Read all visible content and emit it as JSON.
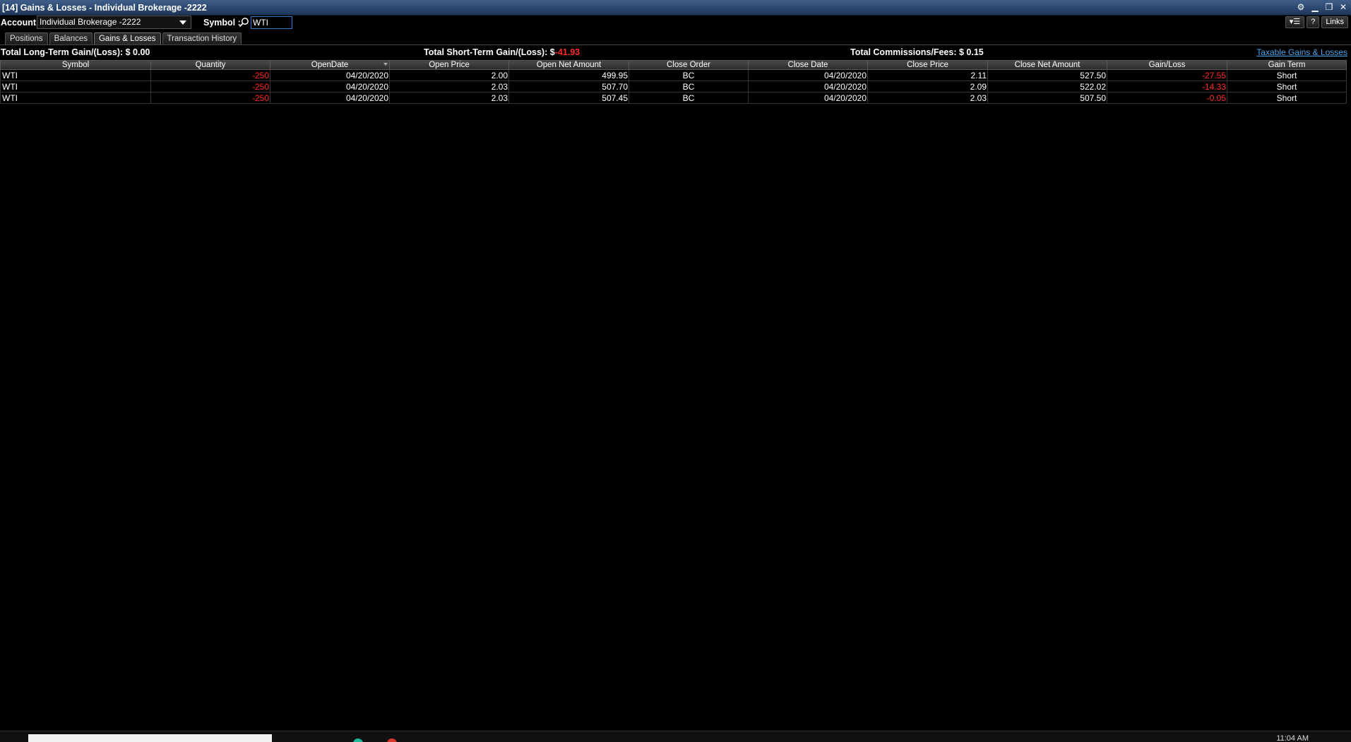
{
  "window": {
    "title": "[14] Gains & Losses - Individual Brokerage -2222"
  },
  "toolbar": {
    "account_label": "Account :",
    "account_value": "Individual Brokerage -2222",
    "symbol_label": "Symbol :",
    "symbol_value": "WTI",
    "help_label": "?",
    "links_label": "Links"
  },
  "tabs": [
    {
      "label": "Positions"
    },
    {
      "label": "Balances"
    },
    {
      "label": "Gains & Losses",
      "active": true
    },
    {
      "label": "Transaction History"
    }
  ],
  "summary": {
    "long_term_label": "Total Long-Term Gain/(Loss):",
    "long_term_value": "$ 0.00",
    "short_term_label": "Total Short-Term Gain/(Loss):",
    "short_term_currency": "$",
    "short_term_value": "-41.93",
    "fees_label": "Total Commissions/Fees:",
    "fees_value": "$ 0.15",
    "taxable_link": "Taxable Gains & Losses"
  },
  "table": {
    "columns": [
      "Symbol",
      "Quantity",
      "OpenDate",
      "Open Price",
      "Open Net Amount",
      "Close Order",
      "Close Date",
      "Close Price",
      "Close Net Amount",
      "Gain/Loss",
      "Gain Term"
    ],
    "rows": [
      [
        "WTI",
        "-250",
        "04/20/2020",
        "2.00",
        "499.95",
        "BC",
        "04/20/2020",
        "2.11",
        "527.50",
        "-27.55",
        "Short"
      ],
      [
        "WTI",
        "-250",
        "04/20/2020",
        "2.03",
        "507.70",
        "BC",
        "04/20/2020",
        "2.09",
        "522.02",
        "-14.33",
        "Short"
      ],
      [
        "WTI",
        "-250",
        "04/20/2020",
        "2.03",
        "507.45",
        "BC",
        "04/20/2020",
        "2.03",
        "507.50",
        "-0.05",
        "Short"
      ]
    ]
  },
  "colors": {
    "negative": "#ff2a2a",
    "link": "#4aa3e8",
    "titlebar": "#2a4a75"
  },
  "taskbar": {
    "clock": "11:04 AM"
  }
}
